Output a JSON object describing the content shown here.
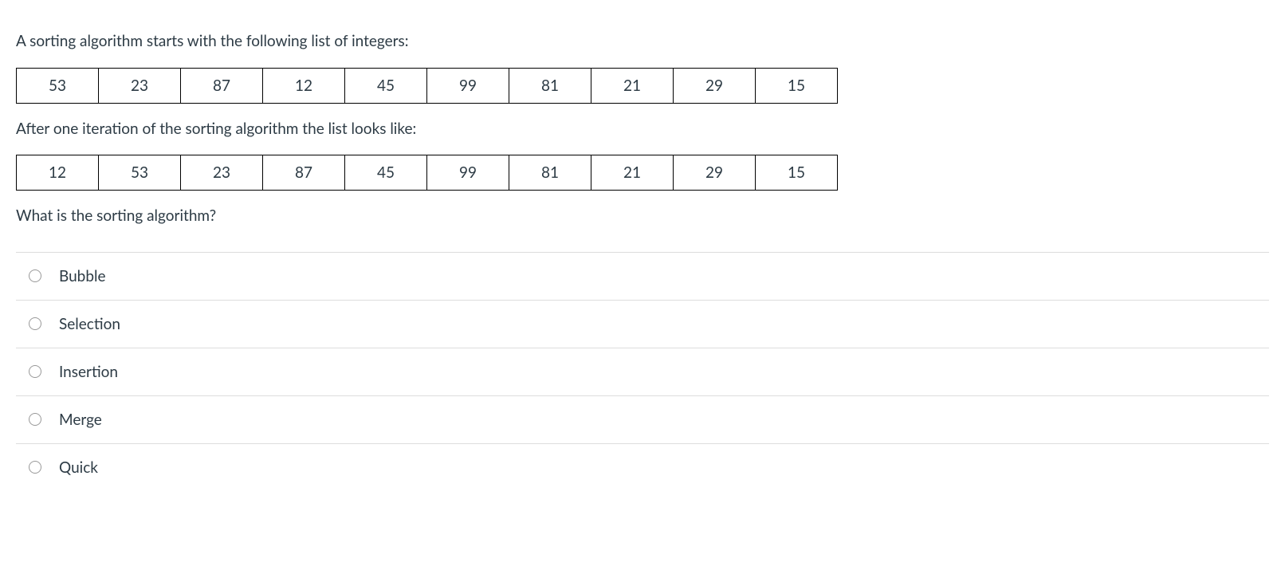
{
  "question": {
    "intro": "A sorting algorithm starts with the following list of integers:",
    "initial_list": [
      "53",
      "23",
      "87",
      "12",
      "45",
      "99",
      "81",
      "21",
      "29",
      "15"
    ],
    "after_text": "After one iteration of the sorting algorithm the list looks like:",
    "after_list": [
      "12",
      "53",
      "23",
      "87",
      "45",
      "99",
      "81",
      "21",
      "29",
      "15"
    ],
    "prompt": "What is the sorting algorithm?"
  },
  "options": [
    {
      "label": "Bubble"
    },
    {
      "label": "Selection"
    },
    {
      "label": "Insertion"
    },
    {
      "label": "Merge"
    },
    {
      "label": "Quick"
    }
  ]
}
